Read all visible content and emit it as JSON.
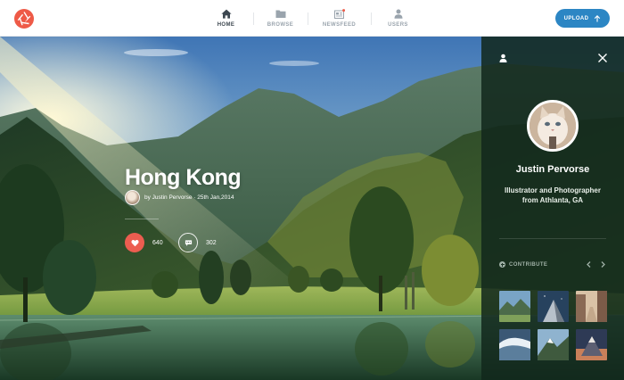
{
  "app": {
    "logo_icon": "aperture-logo-icon",
    "brand_color": "#ee5a47",
    "accent_color": "#2c86c4"
  },
  "nav": {
    "items": [
      {
        "label": "HOME",
        "icon": "home-icon",
        "active": true
      },
      {
        "label": "BROWSE",
        "icon": "folder-icon",
        "active": false
      },
      {
        "label": "NEWSFEED",
        "icon": "newsfeed-icon",
        "active": false
      },
      {
        "label": "USERS",
        "icon": "user-icon",
        "active": false
      }
    ],
    "upload_label": "UPLOAD"
  },
  "photo": {
    "title": "Hong Kong",
    "byline": "by Justin Pervorse · 25th Jan,2014",
    "likes": "640",
    "comments": "302",
    "like_color": "#ec5d50"
  },
  "profile": {
    "name": "Justin Pervorse",
    "bio": "Illustrator and Photographer from Athlanta, GA",
    "contribute_label": "CONTRIBUTE",
    "thumbnails": [
      {
        "subject": "mountain-valley"
      },
      {
        "subject": "mountain-night"
      },
      {
        "subject": "city-street"
      },
      {
        "subject": "ocean-wave"
      },
      {
        "subject": "mountain-peak"
      },
      {
        "subject": "mountain-sunset"
      }
    ]
  }
}
